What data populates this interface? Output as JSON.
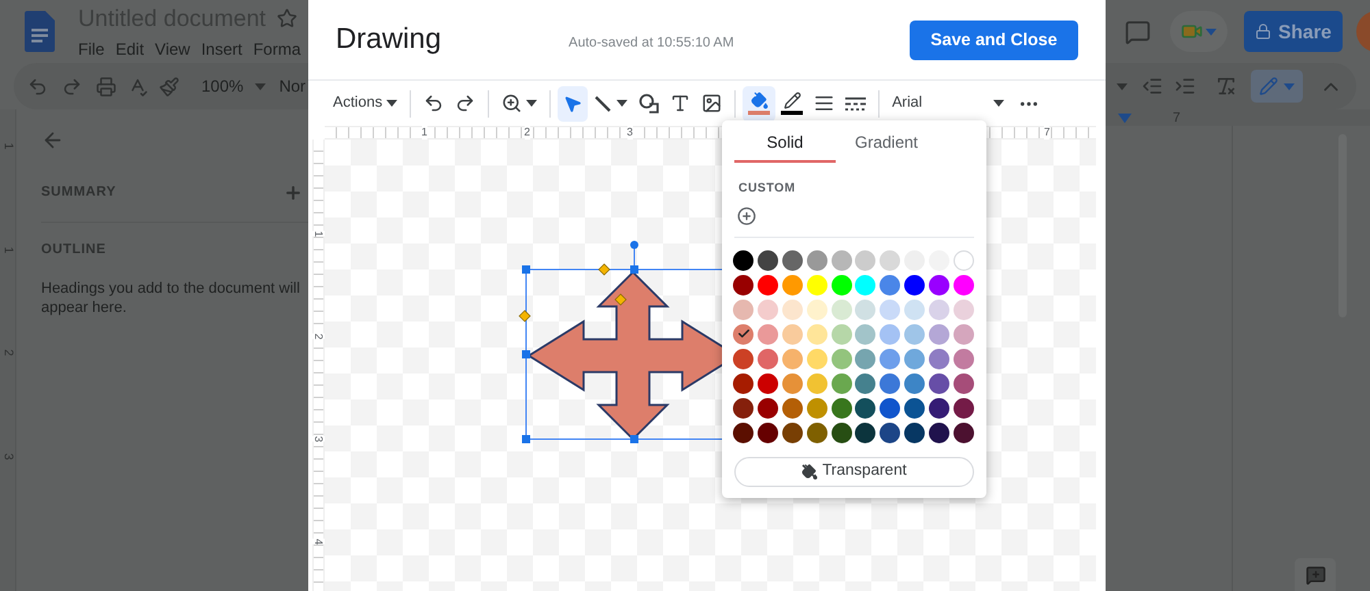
{
  "doc": {
    "title": "Untitled document",
    "menu": [
      "File",
      "Edit",
      "View",
      "Insert",
      "Forma"
    ],
    "zoom": "100%",
    "style": "Nor",
    "share": "Share",
    "ruler_label": "7",
    "sidebar": {
      "summary": "SUMMARY",
      "outline": "OUTLINE",
      "hint": "Headings you add to the document will appear here."
    },
    "vertical_ruler": [
      "1",
      "1",
      "2",
      "3"
    ]
  },
  "drawing": {
    "title": "Drawing",
    "autosave": "Auto-saved at 10:55:10 AM",
    "save": "Save and Close",
    "actions": "Actions",
    "font": "Arial",
    "select_tool": {
      "selected": true
    },
    "fill_tool": {
      "selected": true,
      "color": "#dd7e6b"
    },
    "line_tool": {
      "color": "#000000"
    },
    "h_ruler": [
      "1",
      "2",
      "3",
      "7"
    ],
    "v_ruler": [
      "1",
      "2",
      "3",
      "4"
    ],
    "fill_popover": {
      "tabs": [
        {
          "label": "Solid",
          "selected": true
        },
        {
          "label": "Gradient",
          "selected": false
        }
      ],
      "custom": "CUSTOM",
      "transparent": "Transparent",
      "swatches": [
        {
          "color": "#000000",
          "selected": false
        },
        {
          "color": "#434343",
          "selected": false
        },
        {
          "color": "#666666",
          "selected": false
        },
        {
          "color": "#999999",
          "selected": false
        },
        {
          "color": "#b7b7b7",
          "selected": false
        },
        {
          "color": "#cccccc",
          "selected": false
        },
        {
          "color": "#d9d9d9",
          "selected": false
        },
        {
          "color": "#efefef",
          "selected": false
        },
        {
          "color": "#f3f3f3",
          "selected": false
        },
        {
          "color": "#ffffff",
          "selected": false
        },
        {
          "color": "#980000",
          "selected": false
        },
        {
          "color": "#ff0000",
          "selected": false
        },
        {
          "color": "#ff9900",
          "selected": false
        },
        {
          "color": "#ffff00",
          "selected": false
        },
        {
          "color": "#00ff00",
          "selected": false
        },
        {
          "color": "#00ffff",
          "selected": false
        },
        {
          "color": "#4a86e8",
          "selected": false
        },
        {
          "color": "#0000ff",
          "selected": false
        },
        {
          "color": "#9900ff",
          "selected": false
        },
        {
          "color": "#ff00ff",
          "selected": false
        },
        {
          "color": "#e6b8af",
          "selected": false
        },
        {
          "color": "#f4cccc",
          "selected": false
        },
        {
          "color": "#fce5cd",
          "selected": false
        },
        {
          "color": "#fff2cc",
          "selected": false
        },
        {
          "color": "#d9ead3",
          "selected": false
        },
        {
          "color": "#d0e0e3",
          "selected": false
        },
        {
          "color": "#c9daf8",
          "selected": false
        },
        {
          "color": "#cfe2f3",
          "selected": false
        },
        {
          "color": "#d9d2e9",
          "selected": false
        },
        {
          "color": "#ead1dc",
          "selected": false
        },
        {
          "color": "#dd7e6b",
          "selected": true
        },
        {
          "color": "#ea9999",
          "selected": false
        },
        {
          "color": "#f9cb9c",
          "selected": false
        },
        {
          "color": "#ffe599",
          "selected": false
        },
        {
          "color": "#b6d7a8",
          "selected": false
        },
        {
          "color": "#a2c4c9",
          "selected": false
        },
        {
          "color": "#a4c2f4",
          "selected": false
        },
        {
          "color": "#9fc5e8",
          "selected": false
        },
        {
          "color": "#b4a7d6",
          "selected": false
        },
        {
          "color": "#d5a6bd",
          "selected": false
        },
        {
          "color": "#cc4125",
          "selected": false
        },
        {
          "color": "#e06666",
          "selected": false
        },
        {
          "color": "#f6b26b",
          "selected": false
        },
        {
          "color": "#ffd966",
          "selected": false
        },
        {
          "color": "#93c47d",
          "selected": false
        },
        {
          "color": "#76a5af",
          "selected": false
        },
        {
          "color": "#6d9eeb",
          "selected": false
        },
        {
          "color": "#6fa8dc",
          "selected": false
        },
        {
          "color": "#8e7cc3",
          "selected": false
        },
        {
          "color": "#c27ba0",
          "selected": false
        },
        {
          "color": "#a61c00",
          "selected": false
        },
        {
          "color": "#cc0000",
          "selected": false
        },
        {
          "color": "#e69138",
          "selected": false
        },
        {
          "color": "#f1c232",
          "selected": false
        },
        {
          "color": "#6aa84f",
          "selected": false
        },
        {
          "color": "#45818e",
          "selected": false
        },
        {
          "color": "#3c78d8",
          "selected": false
        },
        {
          "color": "#3d85c6",
          "selected": false
        },
        {
          "color": "#674ea7",
          "selected": false
        },
        {
          "color": "#a64d79",
          "selected": false
        },
        {
          "color": "#85200c",
          "selected": false
        },
        {
          "color": "#990000",
          "selected": false
        },
        {
          "color": "#b45f06",
          "selected": false
        },
        {
          "color": "#bf9000",
          "selected": false
        },
        {
          "color": "#38761d",
          "selected": false
        },
        {
          "color": "#134f5c",
          "selected": false
        },
        {
          "color": "#1155cc",
          "selected": false
        },
        {
          "color": "#0b5394",
          "selected": false
        },
        {
          "color": "#351c75",
          "selected": false
        },
        {
          "color": "#741b47",
          "selected": false
        },
        {
          "color": "#5b0f00",
          "selected": false
        },
        {
          "color": "#660000",
          "selected": false
        },
        {
          "color": "#783f04",
          "selected": false
        },
        {
          "color": "#7f6000",
          "selected": false
        },
        {
          "color": "#274e13",
          "selected": false
        },
        {
          "color": "#0c343d",
          "selected": false
        },
        {
          "color": "#1c4587",
          "selected": false
        },
        {
          "color": "#073763",
          "selected": false
        },
        {
          "color": "#20124d",
          "selected": false
        },
        {
          "color": "#4c1130",
          "selected": false
        }
      ]
    }
  }
}
